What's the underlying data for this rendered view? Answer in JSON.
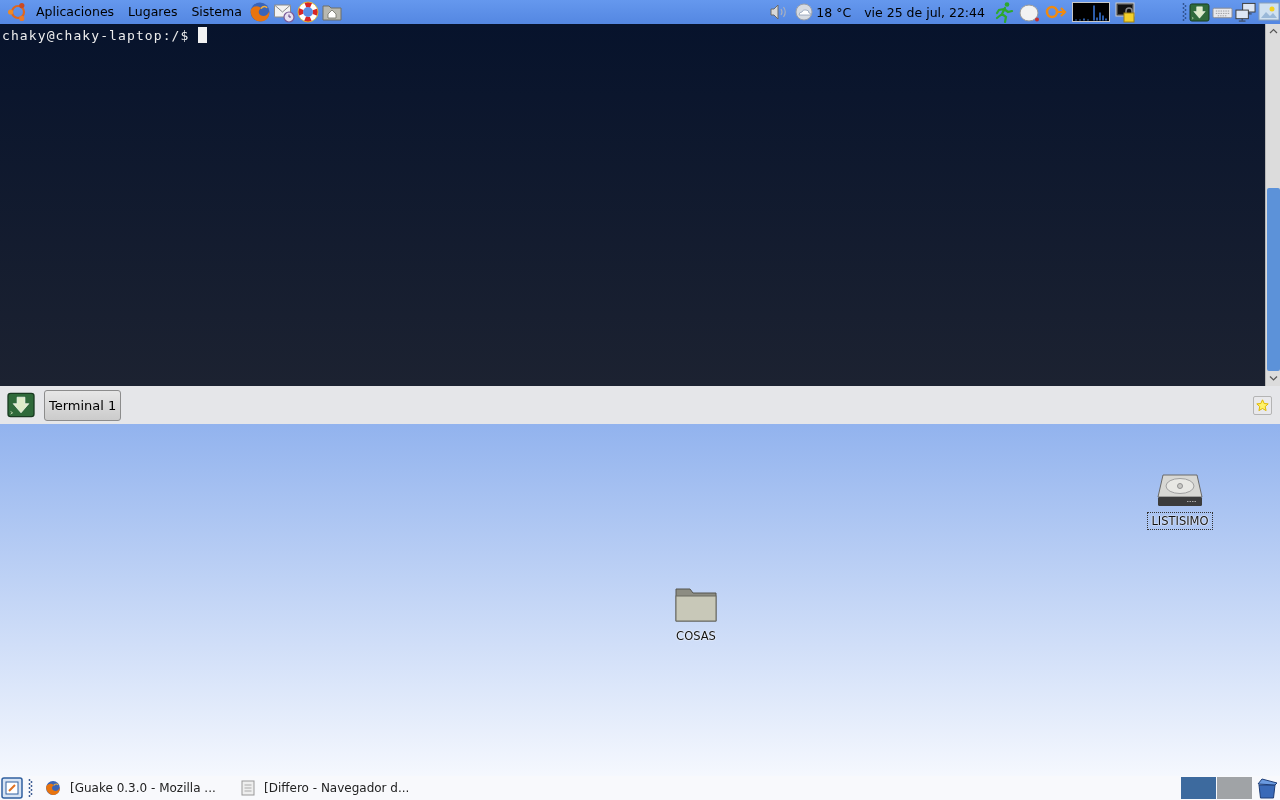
{
  "top_panel": {
    "menus": [
      {
        "label": "Aplicaciones"
      },
      {
        "label": "Lugares"
      },
      {
        "label": "Sistema"
      }
    ],
    "weather": {
      "temperature": "18 °C"
    },
    "clock": "vie 25 de jul, 22:44"
  },
  "terminal": {
    "prompt": "chaky@chaky-laptop:/$",
    "tabs": [
      {
        "label": "Terminal 1",
        "selected": true
      }
    ]
  },
  "desktop": {
    "icons": [
      {
        "kind": "drive",
        "label": "LISTISIMO",
        "selected": true
      },
      {
        "kind": "folder",
        "label": "COSAS",
        "selected": false
      }
    ]
  },
  "bottom_panel": {
    "tasks": [
      {
        "kind": "browser",
        "label": "[Guake 0.3.0 - Mozilla ..."
      },
      {
        "kind": "document",
        "label": "[Differo - Navegador d..."
      }
    ],
    "workspaces": [
      {
        "selected": true
      },
      {
        "selected": false
      }
    ]
  }
}
